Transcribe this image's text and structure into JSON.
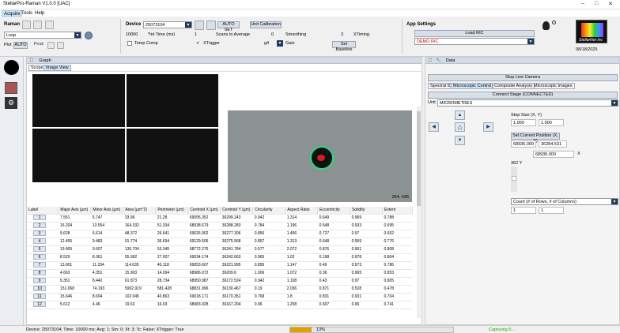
{
  "title": "StellarPro-Raman V1.0.0 [UAC]",
  "menu": [
    "Acquire",
    "Tools",
    "Help"
  ],
  "raman": {
    "label": "Raman",
    "mode": "Loop",
    "plot_label": "Plot",
    "plot_btn": "AUTO",
    "peak_btn": "Peak"
  },
  "device": {
    "label": "Device",
    "value": "25073104",
    "autoset": "AUTO SET",
    "unit_cal": "Unit Calibration",
    "int_time_value": "10000",
    "int_time_label": "*Int Time (ms)",
    "scans_value": "1",
    "scans_label": "Scans to Average",
    "smooth_value": "0",
    "smooth_label": "Smoothing",
    "xtiming_value": "3",
    "xtiming_label": "XTiming",
    "temp_comp": "Temp Comp",
    "xtrigger": "XTrigger",
    "gain_value": "g4",
    "gain_label": "Gain",
    "set_baseline": "Set Baseline"
  },
  "app_settings": {
    "label": "App Settings",
    "load_ric": "Load RIC",
    "ric_value": "DEMO RIC"
  },
  "logo": {
    "text": "StellarNet Inc",
    "date": "08/18/2025"
  },
  "graph": {
    "title": "Graph",
    "tabs": [
      "Scope",
      "Image View"
    ],
    "coord": "354, 436"
  },
  "table": {
    "headers": [
      "Label",
      "Major Axis (µm)",
      "Minor Axis (µm)",
      "Area (µm^2)",
      "Perimeter (µm)",
      "Centroid X (µm)",
      "Centroid Y (µm)",
      "Circularity",
      "Aspect Ratio",
      "Eccentricity",
      "Solidity",
      "Extent"
    ],
    "rows": [
      [
        "1",
        "7.551",
        "5.747",
        "33.96",
        "21.28",
        "69095.352",
        "36299.243",
        "0.942",
        "1.314",
        "0.649",
        "0.969",
        "0.788"
      ],
      [
        "2",
        "16.204",
        "13.554",
        "164.332",
        "51.334",
        "68938.679",
        "36288.283",
        "0.784",
        "1.196",
        "0.548",
        "0.933",
        "0.695"
      ],
      [
        "3",
        "9.628",
        "6.614",
        "48.372",
        "26.641",
        "69026.902",
        "36277.306",
        "0.856",
        "1.456",
        "0.727",
        "0.97",
        "0.652"
      ],
      [
        "4",
        "12.455",
        "9.483",
        "91.774",
        "36.694",
        "69129.506",
        "36275.568",
        "0.857",
        "1.313",
        "0.648",
        "0.959",
        "0.776"
      ],
      [
        "5",
        "19.905",
        "9.607",
        "130.704",
        "53.345",
        "68772.276",
        "36241.784",
        "0.577",
        "2.072",
        "0.876",
        "0.901",
        "0.808"
      ],
      [
        "6",
        "8.529",
        "8.361",
        "55.992",
        "27.007",
        "69034.174",
        "36242.663",
        "0.965",
        "1.02",
        "0.198",
        "0.978",
        "0.804"
      ],
      [
        "7",
        "13.001",
        "11.334",
        "114.635",
        "40.118",
        "69053.607",
        "36221.995",
        "0.895",
        "1.147",
        "0.49",
        "0.973",
        "0.786"
      ],
      [
        "8",
        "4.663",
        "4.351",
        "15.903",
        "14.094",
        "68986.072",
        "36209.6",
        "1.006",
        "1.072",
        "0.36",
        "0.965",
        "0.853"
      ],
      [
        "9",
        "9.351",
        "8.442",
        "61.873",
        "28.734",
        "68950.987",
        "36172.524",
        "0.942",
        "1.108",
        "0.43",
        "0.97",
        "0.805"
      ],
      [
        "10",
        "151.068",
        "74.193",
        "5902.919",
        "581.428",
        "68831.996",
        "36130.467",
        "0.19",
        "2.036",
        "0.871",
        "0.528",
        "0.478"
      ],
      [
        "11",
        "15.646",
        "8.694",
        "102.045",
        "40.863",
        "69018.171",
        "36170.351",
        "0.768",
        "1.8",
        "0.831",
        "0.931",
        "0.704"
      ],
      [
        "12",
        "5.612",
        "4.46",
        "19.63",
        "16.03",
        "68983.928",
        "36167.204",
        "0.96",
        "1.258",
        "0.607",
        "0.96",
        "0.741"
      ]
    ]
  },
  "data": {
    "title": "Data",
    "stop_live": "Stop Live Camera",
    "tabs": [
      "Spectral ID",
      "Microscopic Control",
      "Composite Analysis",
      "Microscopic Images"
    ],
    "connect": "Connect Stage (CONNECTED)",
    "unit_label": "Unit",
    "unit_value": "MICROMETRES",
    "step_label": "Step Size (X, Y)",
    "step_x": "1.000",
    "step_y": "1.000",
    "set_pos": "Set Current Position (X, Y)",
    "pos_x": "68935.000",
    "pos_y": "36284.531",
    "pos_x2": "68935.000",
    "x_label": "X",
    "y_label": "362 Y",
    "count_value": "Count (# of Rows, # of Columns)",
    "count_rows": "1",
    "count_cols": "1"
  },
  "status": {
    "text": "Device: 25073104; Time: 10000 ms; Avg: 1; Sm: 0; Xt: 3; Tc: False; XTrigger: True",
    "progress": 0.13,
    "progress_text": "13%",
    "capturing": "Capturing 5 ..."
  }
}
